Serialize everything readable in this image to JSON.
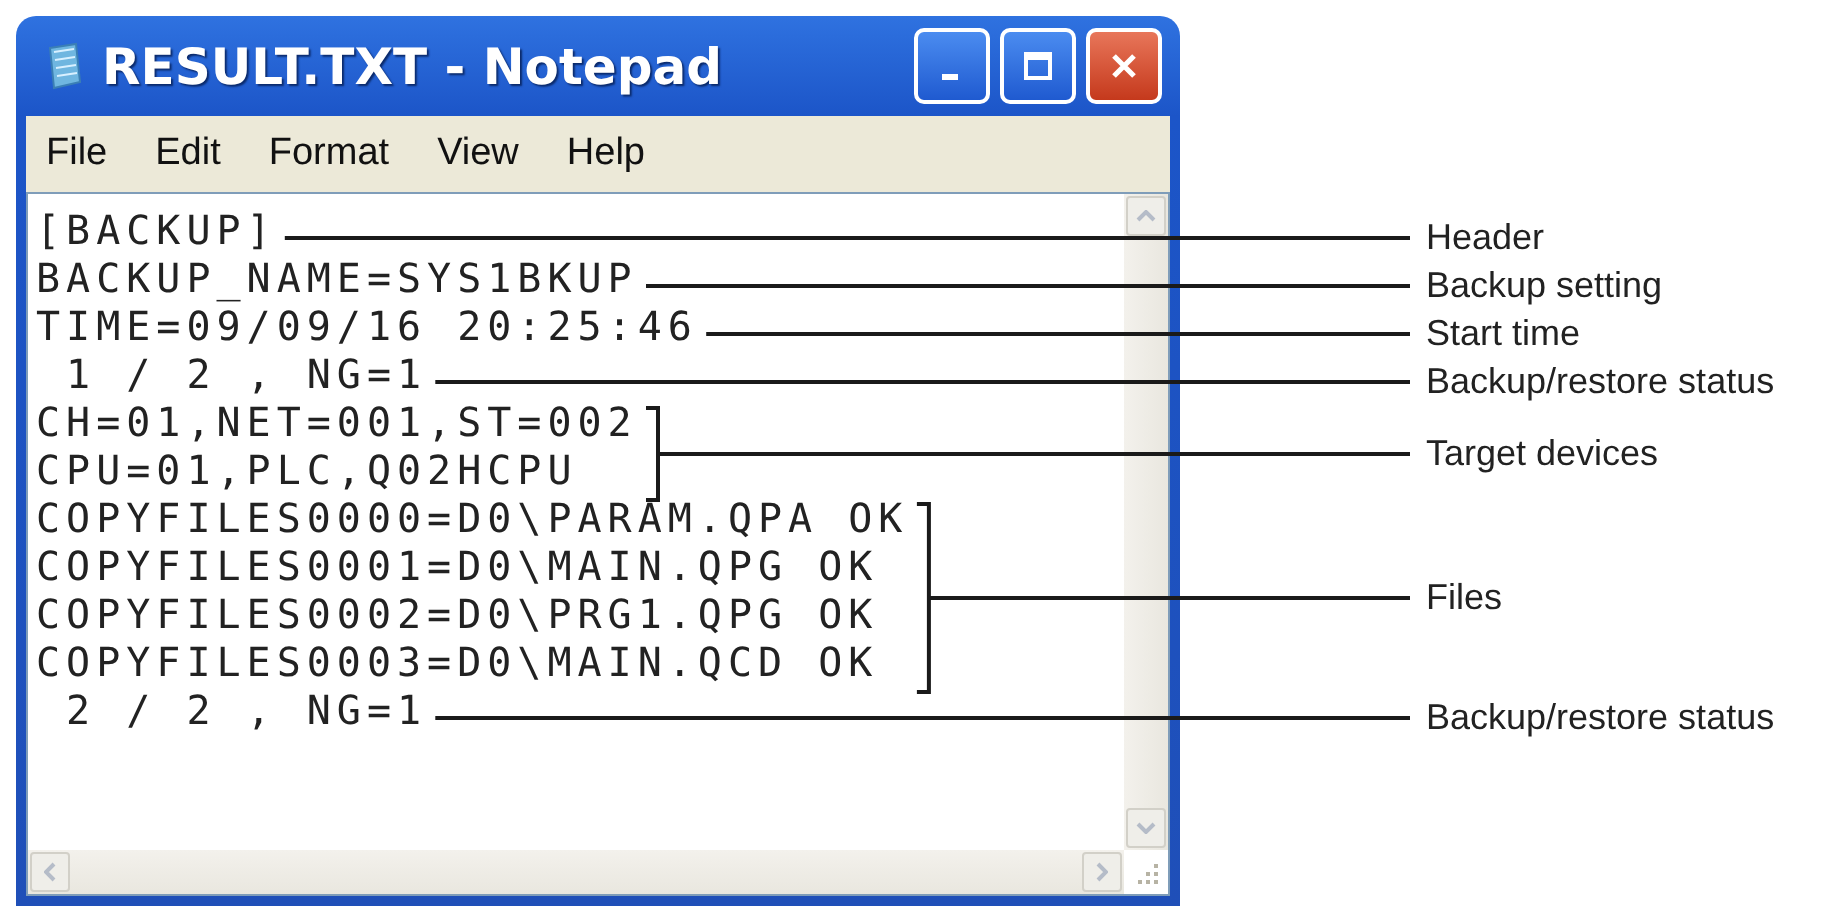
{
  "window": {
    "title": "RESULT.TXT - Notepad"
  },
  "menu": [
    {
      "label": "File"
    },
    {
      "label": "Edit"
    },
    {
      "label": "Format"
    },
    {
      "label": "View"
    },
    {
      "label": "Help"
    }
  ],
  "document": [
    {
      "callout": "Header",
      "lines": [
        "[BACKUP]"
      ]
    },
    {
      "callout": "Backup setting",
      "lines": [
        "BACKUP_NAME=SYS1BKUP"
      ]
    },
    {
      "callout": "Start time",
      "lines": [
        "TIME=09/09/16 20:25:46"
      ]
    },
    {
      "callout": "Backup/restore status",
      "lines": [
        " 1 / 2 , NG=1"
      ]
    },
    {
      "callout": "Target devices",
      "lines": [
        "CH=01,NET=001,ST=002",
        "CPU=01,PLC,Q02HCPU"
      ]
    },
    {
      "callout": "Files",
      "lines": [
        "COPYFILES0000=D0\\PARAM.QPA OK",
        "COPYFILES0001=D0\\MAIN.QPG OK",
        "COPYFILES0002=D0\\PRG1.QPG OK",
        "COPYFILES0003=D0\\MAIN.QCD OK"
      ]
    },
    {
      "callout": "Backup/restore status",
      "lines": [
        " 2 / 2 , NG=1"
      ]
    }
  ]
}
